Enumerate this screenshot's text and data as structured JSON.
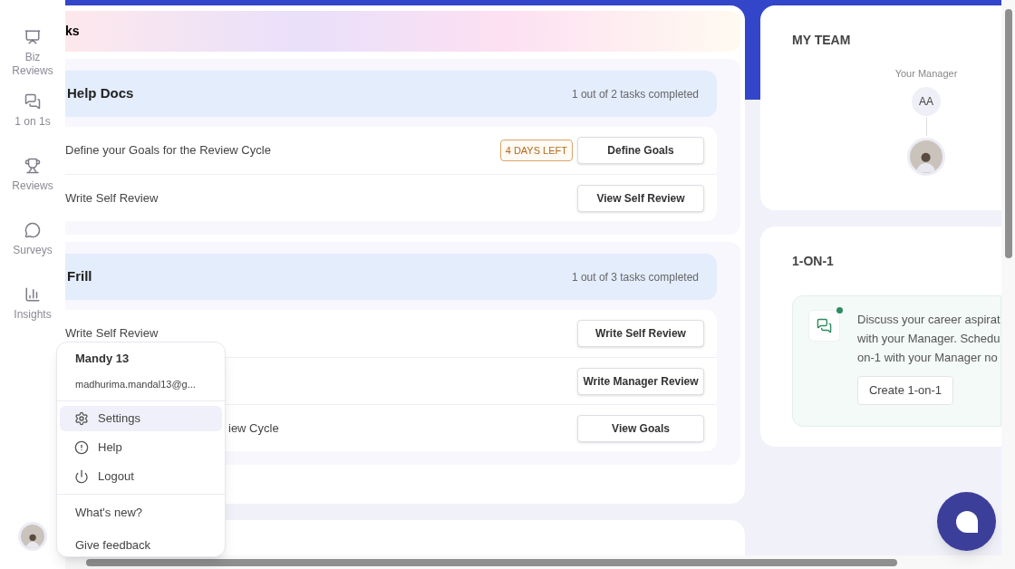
{
  "sidebar": {
    "items": [
      {
        "label": "Biz Reviews",
        "kind": "presentation"
      },
      {
        "label": "1 on 1s",
        "kind": "chat"
      },
      {
        "label": "Reviews",
        "kind": "trophy"
      },
      {
        "label": "Surveys",
        "kind": "bubble"
      },
      {
        "label": "Insights",
        "kind": "chart"
      }
    ]
  },
  "banner": {
    "title": "ks"
  },
  "groups": [
    {
      "title": "Help Docs",
      "progress": "1 out of 2 tasks completed",
      "tasks": [
        {
          "label": "Define your Goals for the Review Cycle",
          "badge": "4 DAYS LEFT",
          "button": "Define Goals",
          "kind": "plain"
        },
        {
          "label": "Write Self Review",
          "button": "View Self Review",
          "kind": "plain"
        }
      ]
    },
    {
      "title": "Frill",
      "progress": "1 out of 3 tasks completed",
      "tasks": [
        {
          "label": "Write Self Review",
          "button": "Write Self Review",
          "kind": "plain"
        },
        {
          "button": "Write Manager Review",
          "kind": "plain"
        },
        {
          "label": "iew Cycle",
          "button": "View Goals",
          "kind": "behind-menu"
        }
      ]
    }
  ],
  "account_menu": {
    "name": "Mandy 13",
    "email": "madhurima.mandal13@g...",
    "items": [
      {
        "label": "Settings",
        "selected": true
      },
      {
        "label": "Help",
        "selected": false
      },
      {
        "label": "Logout",
        "selected": false
      }
    ],
    "links": [
      "What's new?",
      "Give feedback"
    ]
  },
  "my_team": {
    "title": "MY TEAM",
    "manager_label": "Your Manager",
    "manager_initials": "AA"
  },
  "one_on_one": {
    "title": "1-ON-1",
    "lines": [
      "Discuss your career aspirat",
      "with your Manager. Schedu",
      "on-1 with your Manager no"
    ],
    "button": "Create 1-on-1"
  }
}
